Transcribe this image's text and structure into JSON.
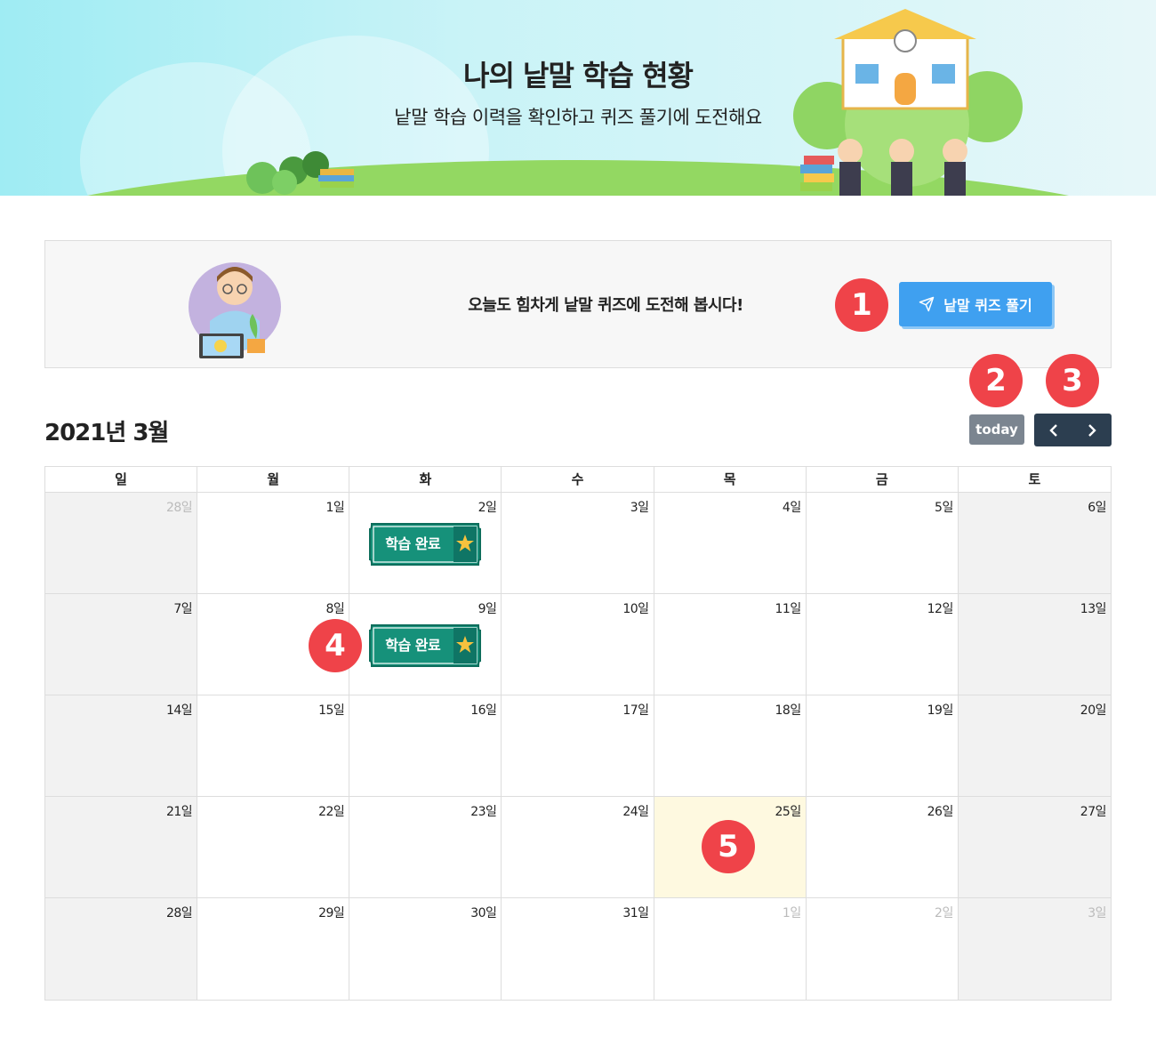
{
  "banner": {
    "title": "나의 낱말 학습 현황",
    "subtitle": "낱말 학습 이력을 확인하고 퀴즈 풀기에 도전해요"
  },
  "quiz": {
    "message": "오늘도 힘차게 낱말 퀴즈에 도전해 봅시다!",
    "button_label": "낱말 퀴즈 풀기",
    "button_icon": "paper-plane-icon"
  },
  "calendar": {
    "title": "2021년 3월",
    "today_label": "today",
    "weekdays": [
      "일",
      "월",
      "화",
      "수",
      "목",
      "금",
      "토"
    ],
    "weeks": [
      [
        "28일",
        "1일",
        "2일",
        "3일",
        "4일",
        "5일",
        "6일"
      ],
      [
        "7일",
        "8일",
        "9일",
        "10일",
        "11일",
        "12일",
        "13일"
      ],
      [
        "14일",
        "15일",
        "16일",
        "17일",
        "18일",
        "19일",
        "20일"
      ],
      [
        "21일",
        "22일",
        "23일",
        "24일",
        "25일",
        "26일",
        "27일"
      ],
      [
        "28일",
        "29일",
        "30일",
        "31일",
        "1일",
        "2일",
        "3일"
      ]
    ],
    "done_label": "학습 완료"
  },
  "annotations": [
    "1",
    "2",
    "3",
    "4",
    "5"
  ],
  "colors": {
    "accent_blue": "#3fa0f0",
    "badge_red": "#ef4349",
    "done_green": "#16917a",
    "today_bg": "#fef9e0",
    "nav_dark": "#2c3e50"
  }
}
